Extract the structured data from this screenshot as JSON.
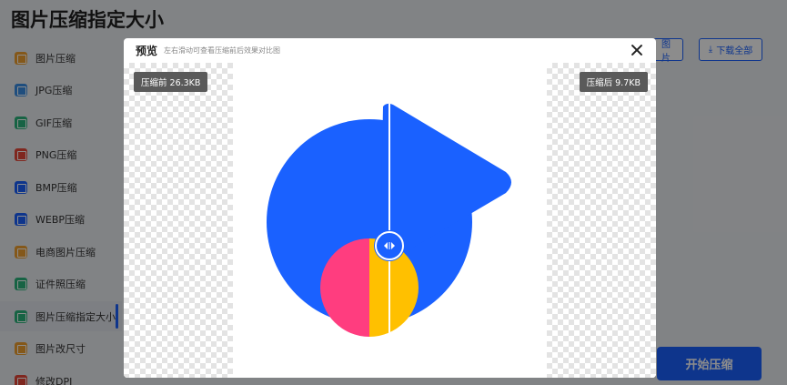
{
  "app": {
    "title": "图片压缩指定大小"
  },
  "sidebar": {
    "items": [
      {
        "label": "图片压缩",
        "icon": "image-compress-icon",
        "color": "#f0a030",
        "active": false
      },
      {
        "label": "JPG压缩",
        "icon": "jpg-icon",
        "color": "#3a8ee6",
        "active": false
      },
      {
        "label": "GIF压缩",
        "icon": "gif-icon",
        "color": "#2ab57d",
        "active": false
      },
      {
        "label": "PNG压缩",
        "icon": "png-icon",
        "color": "#e8483a",
        "active": false
      },
      {
        "label": "BMP压缩",
        "icon": "bmp-icon",
        "color": "#1a61ff",
        "active": false
      },
      {
        "label": "WEBP压缩",
        "icon": "webp-icon",
        "color": "#1a61ff",
        "active": false
      },
      {
        "label": "电商图片压缩",
        "icon": "ecommerce-icon",
        "color": "#f0a030",
        "active": false
      },
      {
        "label": "证件照压缩",
        "icon": "id-photo-icon",
        "color": "#2ab57d",
        "active": false
      },
      {
        "label": "图片压缩指定大小",
        "icon": "size-target-icon",
        "color": "#2ab57d",
        "active": true
      },
      {
        "label": "图片改尺寸",
        "icon": "resize-icon",
        "color": "#f0a030",
        "active": false
      },
      {
        "label": "修改DPI",
        "icon": "dpi-icon",
        "color": "#e8483a",
        "active": false
      }
    ]
  },
  "toolbar": {
    "add_label": "图片",
    "download_all_label": "下载全部",
    "start_label": "开始压缩"
  },
  "modal": {
    "title": "预览",
    "hint": "左右滑动可查看压缩前后效果对比图",
    "before_label": "压缩前 26.3KB",
    "after_label": "压缩后 9.7KB"
  },
  "colors": {
    "accent": "#1a61ff",
    "shape_blue": "#1a61ff",
    "shape_pink": "#ff3d7f",
    "shape_yellow": "#ffc000"
  }
}
